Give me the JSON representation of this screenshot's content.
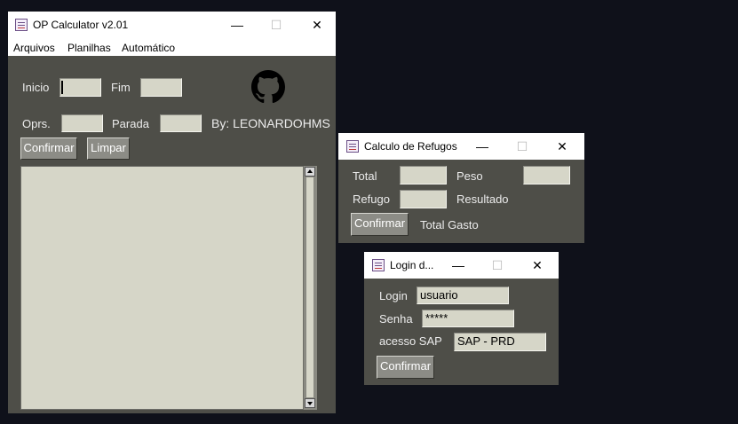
{
  "main_window": {
    "title": "OP Calculator v2.01",
    "menu": [
      "Arquivos",
      "Planilhas",
      "Automático"
    ],
    "labels": {
      "inicio": "Inicio",
      "fim": "Fim",
      "oprs": "Oprs.",
      "parada": "Parada",
      "credit": "By: LEONARDOHMS"
    },
    "fields": {
      "inicio": "",
      "fim": "",
      "oprs": "",
      "parada": ""
    },
    "buttons": {
      "confirmar": "Confirmar",
      "limpar": "Limpar"
    },
    "output": ""
  },
  "refugos_window": {
    "title": "Calculo de Refugos",
    "labels": {
      "total": "Total",
      "peso": "Peso",
      "refugo": "Refugo",
      "resultado": "Resultado",
      "total_gasto": "Total Gasto"
    },
    "fields": {
      "total": "",
      "peso": "",
      "refugo": ""
    },
    "buttons": {
      "confirmar": "Confirmar"
    }
  },
  "login_window": {
    "title": "Login d...",
    "labels": {
      "login": "Login",
      "senha": "Senha",
      "acesso": "acesso SAP"
    },
    "fields": {
      "login": "usuario",
      "senha": "*****",
      "acesso": "SAP - PRD"
    },
    "buttons": {
      "confirmar": "Confirmar"
    }
  },
  "window_controls": {
    "minimize": "—",
    "maximize": "☐",
    "close": "✕"
  },
  "icons": [
    "app-icon",
    "github-icon",
    "minimize-icon",
    "maximize-icon",
    "close-icon",
    "scroll-up-icon",
    "scroll-down-icon"
  ]
}
